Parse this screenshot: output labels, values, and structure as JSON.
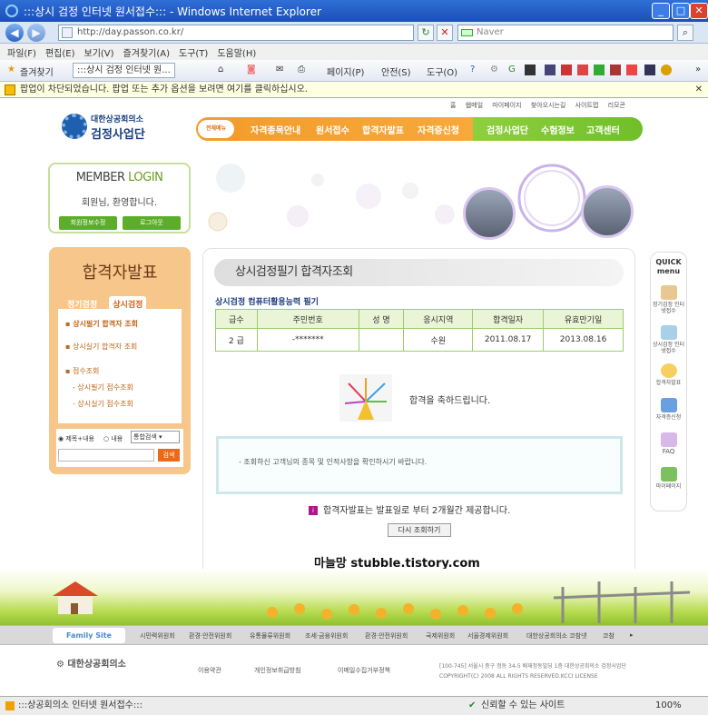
{
  "window": {
    "title": ":::상시 검정 인터넷 원서접수::: - Windows Internet Explorer"
  },
  "address": {
    "url": "http://day.passon.co.kr/",
    "search_placeholder": "Naver"
  },
  "menubar": [
    "파일(F)",
    "편집(E)",
    "보기(V)",
    "즐겨찾기(A)",
    "도구(T)",
    "도움말(H)"
  ],
  "favbar": {
    "favorites": "즐겨찾기",
    "tab": ":::상시 검정 인터넷 원...",
    "page": "페이지(P)",
    "safety": "안전(S)",
    "tools": "도구(O)"
  },
  "infobar": {
    "text": "팝업이 차단되었습니다. 팝업 또는 추가 옵션을 보려면 여기를 클릭하십시오."
  },
  "utility": [
    "홈",
    "웹메일",
    "마이페이지",
    "찾아오시는길",
    "사이트맵",
    "리모콘"
  ],
  "logo": {
    "line1": "대한상공회의소",
    "line2": "검정사업단"
  },
  "gnb": {
    "all": "전체메뉴",
    "items": [
      "자격종목안내",
      "원서접수",
      "합격자발표",
      "자격증신청",
      "검정사업단",
      "수험정보",
      "고객센터"
    ]
  },
  "login": {
    "title_member": "MEMBER",
    "title_login": " LOGIN",
    "greeting": "회원님, 환영합니다.",
    "edit": "회원정보수정",
    "logout": "로그아웃"
  },
  "lnb": {
    "title": "합격자발표",
    "tab1": "정기검정",
    "tab2": "상시검정",
    "items": [
      "▪ 상시필기 합격자 조회",
      "▪ 상시실기 합격자 조회",
      "▪ 점수조회",
      "- 상시필기 점수조회",
      "- 상시실기 점수조회"
    ],
    "radio1": "제목+내용",
    "radio2": "내용",
    "select": "통합검색",
    "search_btn": "검색"
  },
  "main": {
    "title": "상시검정필기 합격자조회",
    "subtitle": "상시검정 컴퓨터활용능력 필기",
    "headers": [
      "급수",
      "주민번호",
      "성 명",
      "응시지역",
      "합격일자",
      "유효만기일"
    ],
    "rows": [
      [
        "2 급",
        "-*******",
        "",
        "수원",
        "2011.08.17",
        "2013.08.16"
      ]
    ],
    "congrats": "합격을 축하드립니다.",
    "notice": "- 조회하신 고객님의 종목 및 인적사항을 확인하시기 바랍니다.",
    "period": "합격자발표는 발표일로 부터 2개월간 제공합니다.",
    "retry": "다시 조회하기",
    "watermark": "마늘망 stubble.tistory.com"
  },
  "quick": {
    "title1": "QUICK",
    "title2": "menu",
    "items": [
      "정기검정 인터넷접수",
      "상시검정 인터넷접수",
      "합격자발표",
      "자격증신청",
      "FAQ",
      "마이페이지"
    ]
  },
  "family": {
    "label": "Family Site",
    "items": [
      "시민력위원회",
      "환경·안전위원회",
      "유통물류위원회",
      "조세·금융위원회",
      "환경·안전위원회",
      "국제위원회",
      "서울경제위원회",
      "대한상공회의소 코참넷",
      "코참"
    ]
  },
  "footer": {
    "logo": "대한상공회의소",
    "links": [
      "이용약관",
      "개인정보취급방침",
      "이메일수집거부정책"
    ],
    "addr1": "[100-745] 서울시 중구 정동 34-5 배재정동빌딩 1층 대한상공회의소 검정사업단",
    "addr2": "COPYRIGHT(C) 2008 ALL RIGHTS RESERVED.KCCI LICENSE"
  },
  "status": {
    "left": ":::상공회의소 인터넷 원서접수:::",
    "zone": "신뢰할 수 있는 사이트",
    "zoom": "100%"
  }
}
